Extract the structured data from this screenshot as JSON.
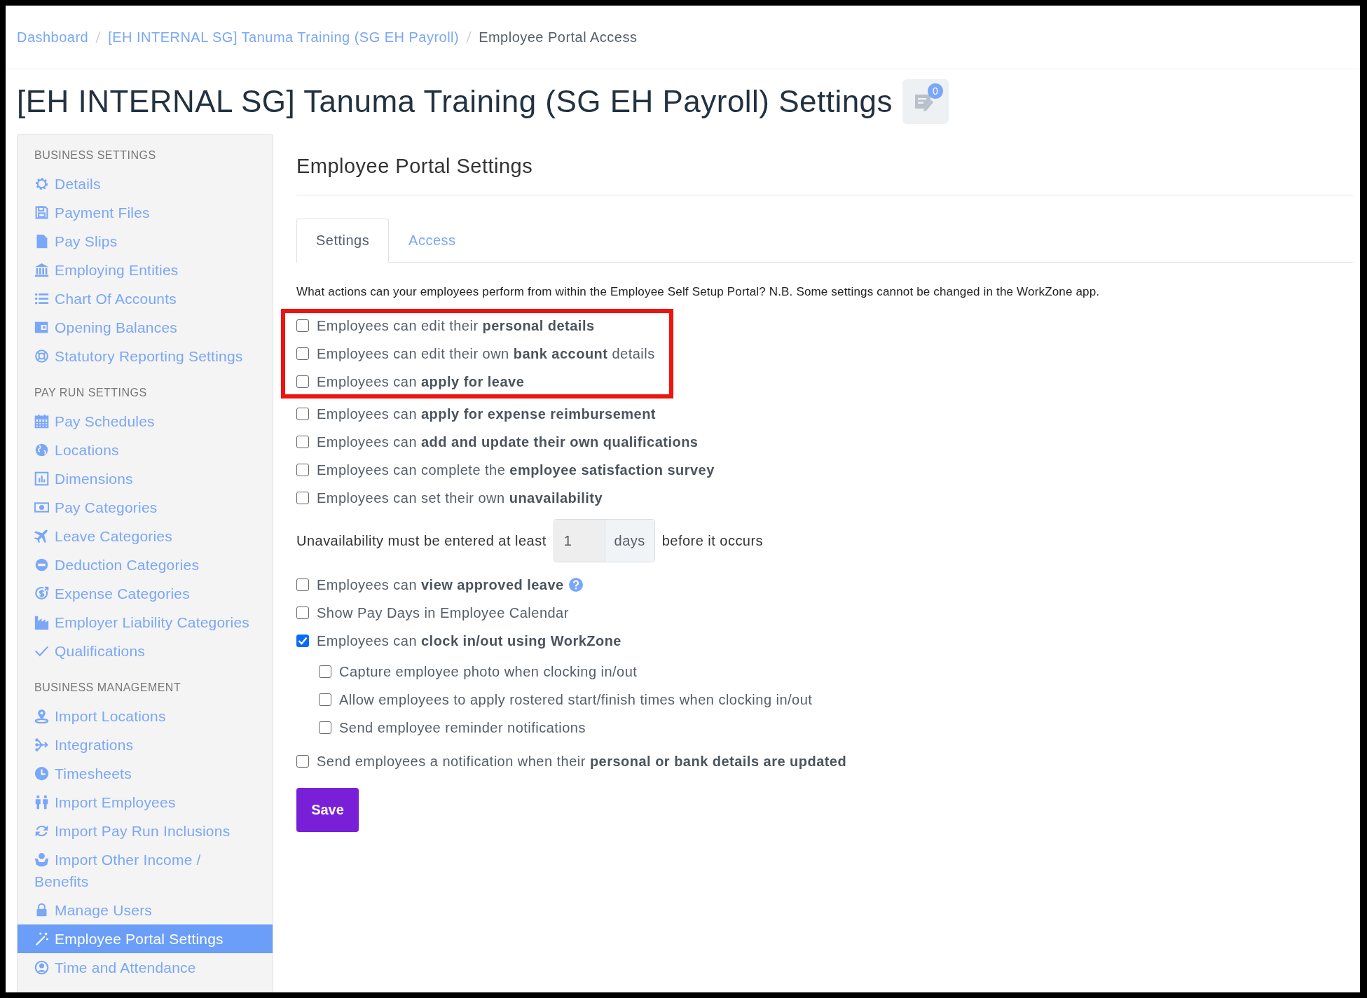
{
  "breadcrumb": [
    {
      "label": "Dashboard",
      "link": true
    },
    {
      "label": "[EH INTERNAL SG] Tanuma Training (SG EH Payroll)",
      "link": true
    },
    {
      "label": "Employee Portal Access",
      "link": false
    }
  ],
  "page_title": "[EH INTERNAL SG] Tanuma Training (SG EH Payroll) Settings",
  "notes_badge": "0",
  "sidebar": [
    {
      "heading": "BUSINESS SETTINGS",
      "items": [
        {
          "label": "Details",
          "selected": false
        },
        {
          "label": "Payment Files",
          "selected": false
        },
        {
          "label": "Pay Slips",
          "selected": false
        },
        {
          "label": "Employing Entities",
          "selected": false
        },
        {
          "label": "Chart Of Accounts",
          "selected": false
        },
        {
          "label": "Opening Balances",
          "selected": false
        },
        {
          "label": "Statutory Reporting Settings",
          "selected": false
        }
      ]
    },
    {
      "heading": "PAY RUN SETTINGS",
      "items": [
        {
          "label": "Pay Schedules",
          "selected": false
        },
        {
          "label": "Locations",
          "selected": false
        },
        {
          "label": "Dimensions",
          "selected": false
        },
        {
          "label": "Pay Categories",
          "selected": false
        },
        {
          "label": "Leave Categories",
          "selected": false
        },
        {
          "label": "Deduction Categories",
          "selected": false
        },
        {
          "label": "Expense Categories",
          "selected": false
        },
        {
          "label": "Employer Liability Categories",
          "selected": false
        },
        {
          "label": "Qualifications",
          "selected": false
        }
      ]
    },
    {
      "heading": "BUSINESS MANAGEMENT",
      "items": [
        {
          "label": "Import Locations",
          "selected": false
        },
        {
          "label": "Integrations",
          "selected": false
        },
        {
          "label": "Timesheets",
          "selected": false
        },
        {
          "label": "Import Employees",
          "selected": false
        },
        {
          "label": "Import Pay Run Inclusions",
          "selected": false
        },
        {
          "label": "Import Other Income / Benefits",
          "selected": false
        },
        {
          "label": "Manage Users",
          "selected": false
        },
        {
          "label": "Employee Portal Settings",
          "selected": true
        },
        {
          "label": "Time and Attendance",
          "selected": false
        }
      ]
    }
  ],
  "section_title": "Employee Portal Settings",
  "tabs": [
    {
      "label": "Settings",
      "selected": true
    },
    {
      "label": "Access",
      "selected": false
    }
  ],
  "description": "What actions can your employees perform from within the Employee Self Setup Portal? N.B. Some settings cannot be changed in the WorkZone app.",
  "options": [
    {
      "kind": "checkbox",
      "label": "Employees can edit their **personal details**",
      "checked": false,
      "highlighted": true
    },
    {
      "kind": "checkbox",
      "label": "Employees can edit their own **bank account** details",
      "checked": false,
      "highlighted": true
    },
    {
      "kind": "checkbox",
      "label": "Employees can **apply for leave**",
      "checked": false,
      "highlighted": true
    },
    {
      "kind": "checkbox",
      "label": "Employees can **apply for expense reimbursement**",
      "checked": false,
      "highlighted": false
    },
    {
      "kind": "checkbox",
      "label": "Employees can **add and update their own qualifications**",
      "checked": false,
      "highlighted": false
    },
    {
      "kind": "checkbox",
      "label": "Employees can complete the **employee satisfaction survey**",
      "checked": false,
      "highlighted": false
    },
    {
      "kind": "checkbox",
      "label": "Employees can set their own **unavailability**",
      "checked": false,
      "highlighted": false
    },
    {
      "kind": "lead_time",
      "text_before": "Unavailability must be entered at least",
      "value": "1",
      "unit": "days",
      "text_after": "before it occurs",
      "highlighted": false
    },
    {
      "kind": "checkbox",
      "label": "Employees can **view approved leave**",
      "checked": false,
      "help": true,
      "highlighted": false
    },
    {
      "kind": "checkbox",
      "label": "Show Pay Days in Employee Calendar",
      "checked": false,
      "highlighted": false
    },
    {
      "kind": "checkbox",
      "label": "Employees can **clock in/out using WorkZone**",
      "checked": true,
      "highlighted": false,
      "children": [
        {
          "label": "Capture employee photo when clocking in/out",
          "checked": false
        },
        {
          "label": "Allow employees to apply rostered start/finish times when clocking in/out",
          "checked": false
        },
        {
          "label": "Send employee reminder notifications",
          "checked": false
        }
      ]
    },
    {
      "kind": "checkbox",
      "label": "Send employees a notification when their **personal or bank details are updated**",
      "checked": false,
      "highlighted": false
    }
  ],
  "save_button": "Save"
}
